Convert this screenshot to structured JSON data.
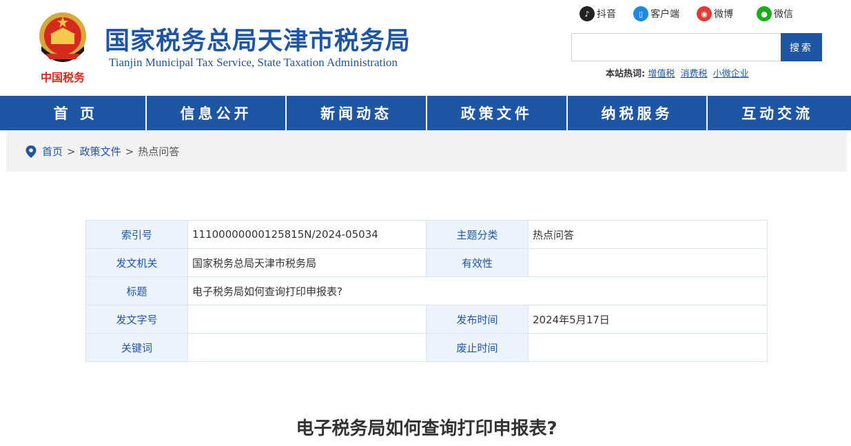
{
  "header": {
    "title_cn": "国家税务总局天津市税务局",
    "title_en": "Tianjin Municipal Tax Service, State Taxation Administration",
    "emblem_text": "中国税务"
  },
  "social": [
    {
      "label": "抖音",
      "icon": "douyin-icon"
    },
    {
      "label": "客户端",
      "icon": "mobile-app-icon"
    },
    {
      "label": "微博",
      "icon": "weibo-icon"
    },
    {
      "label": "微信",
      "icon": "wechat-icon"
    }
  ],
  "search": {
    "placeholder": "",
    "button": "搜索",
    "hot_label": "本站热词:",
    "hot_words": [
      "增值税",
      "消费税",
      "小微企业"
    ]
  },
  "nav": [
    "首 页",
    "信息公开",
    "新闻动态",
    "政策文件",
    "纳税服务",
    "互动交流"
  ],
  "breadcrumb": {
    "items": [
      "首页",
      "政策文件"
    ],
    "current": "热点问答",
    "separator": ">"
  },
  "meta": {
    "index_label": "索引号",
    "index_value": "11100000000125815N/2024-05034",
    "topic_label": "主题分类",
    "topic_value": "热点问答",
    "issuer_label": "发文机关",
    "issuer_value": "国家税务总局天津市税务局",
    "validity_label": "有效性",
    "validity_value": "",
    "title_label": "标题",
    "title_value": "电子税务局如何查询打印申报表?",
    "docno_label": "发文字号",
    "docno_value": "",
    "pubdate_label": "发布时间",
    "pubdate_value": "2024年5月17日",
    "keywords_label": "关键词",
    "keywords_value": "",
    "expire_label": "废止时间",
    "expire_value": ""
  },
  "article": {
    "title": "电子税务局如何查询打印申报表?"
  },
  "colors": {
    "brand_blue": "#1f56a3",
    "label_bg": "#edf3fa",
    "crumb_bg": "#f2f2f2"
  }
}
